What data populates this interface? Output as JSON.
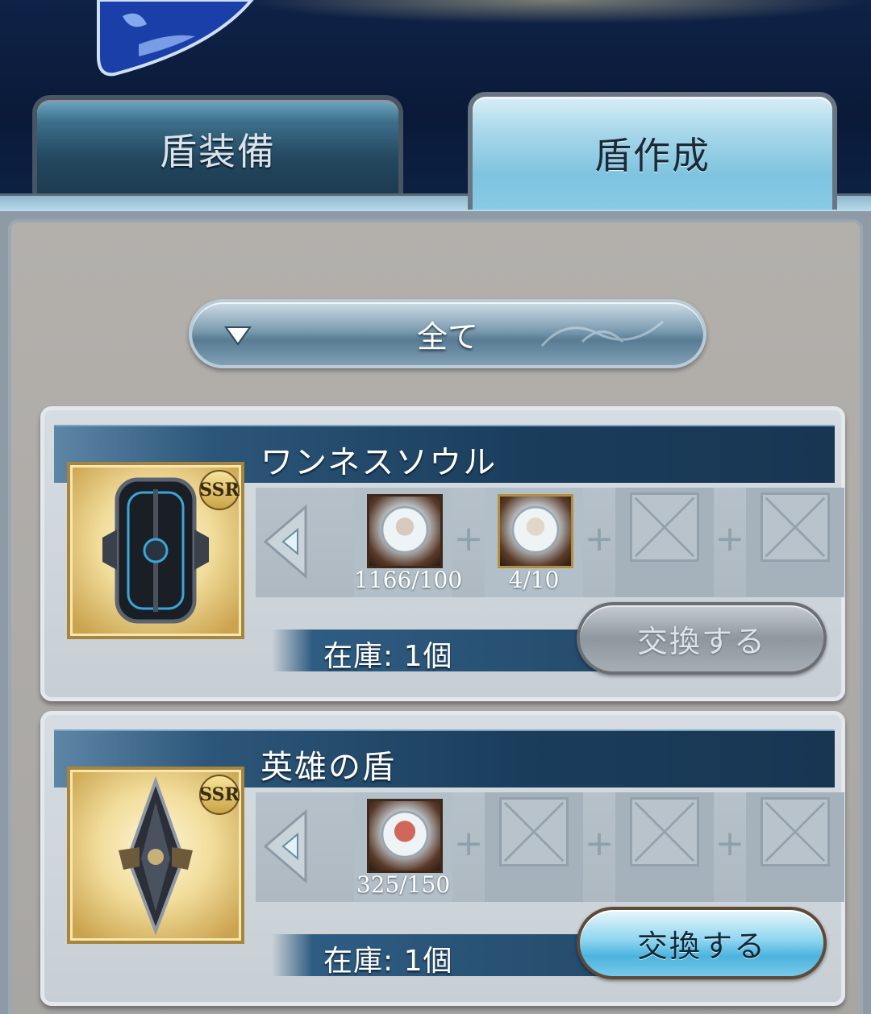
{
  "tabs": {
    "equip_label": "盾装備",
    "create_label": "盾作成",
    "active": "create"
  },
  "filter": {
    "label": "全て",
    "icon": "chevron-down-icon"
  },
  "recipes": [
    {
      "name": "ワンネスソウル",
      "rarity": "SSR",
      "materials": [
        {
          "count": "1166/100",
          "frame": "bronze"
        },
        {
          "count": "4/10",
          "frame": "gold"
        }
      ],
      "empty_slots": 2,
      "stock": "在庫: 1個",
      "button_label": "交換する",
      "button_enabled": false
    },
    {
      "name": "英雄の盾",
      "rarity": "SSR",
      "materials": [
        {
          "count": "325/150",
          "frame": "bronze"
        }
      ],
      "empty_slots": 3,
      "stock": "在庫: 1個",
      "button_label": "交換する",
      "button_enabled": true
    }
  ],
  "colors": {
    "header_bg": "#0c1a33",
    "tab_active": "#87cbe4",
    "title_bar": "#1a3d5c",
    "button_enabled": "#4cb3de"
  }
}
